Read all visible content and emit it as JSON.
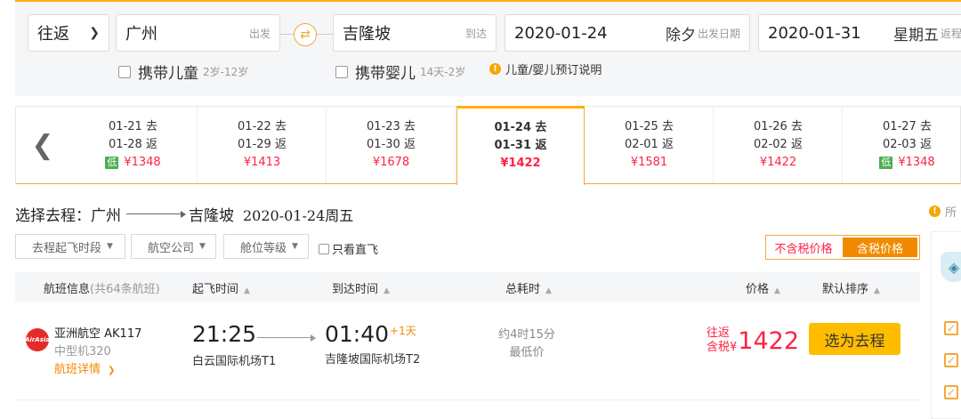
{
  "search": {
    "trip_type": "往返",
    "from_city": "广州",
    "from_hint": "出发",
    "to_city": "吉隆坡",
    "to_hint": "到达",
    "depart_date": "2020-01-24",
    "depart_day": "除夕",
    "depart_hint": "出发日期",
    "return_date": "2020-01-31",
    "return_day": "星期五",
    "return_hint": "返程",
    "child_label": "携带儿童",
    "child_age": "2岁-12岁",
    "infant_label": "携带婴儿",
    "infant_age": "14天-2岁",
    "booking_note": "儿童/婴儿预订说明"
  },
  "date_strip": [
    {
      "go": "01-21 去",
      "back": "01-28 返",
      "price": "¥1348",
      "low": "低",
      "active": false
    },
    {
      "go": "01-22 去",
      "back": "01-29 返",
      "price": "¥1413",
      "low": "",
      "active": false
    },
    {
      "go": "01-23 去",
      "back": "01-30 返",
      "price": "¥1678",
      "low": "",
      "active": false
    },
    {
      "go": "01-24 去",
      "back": "01-31 返",
      "price": "¥1422",
      "low": "",
      "active": true
    },
    {
      "go": "01-25 去",
      "back": "02-01 返",
      "price": "¥1581",
      "low": "",
      "active": false
    },
    {
      "go": "01-26 去",
      "back": "02-02 返",
      "price": "¥1422",
      "low": "",
      "active": false
    },
    {
      "go": "01-27 去",
      "back": "02-03 返",
      "price": "¥1348",
      "low": "低",
      "active": false
    }
  ],
  "outbound": {
    "prefix": "选择去程：",
    "from": "广州",
    "to": "吉隆坡",
    "date": "2020-01-24周五",
    "side_tip": "所"
  },
  "filters": {
    "depart_period": "去程起飞时段",
    "airline": "航空公司",
    "cabin": "舱位等级",
    "direct_only": "只看直飞",
    "price_excl_tax": "不含税价格",
    "price_incl_tax": "含税价格"
  },
  "table_header": {
    "flight_info": "航班信息",
    "flight_count": "(共64条航班)",
    "depart_time": "起飞时间",
    "arrive_time": "到达时间",
    "duration": "总耗时",
    "price": "价格",
    "sort": "默认排序"
  },
  "flight": {
    "logo_text": "AirAsia",
    "airline": "亚洲航空 AK117",
    "aircraft": "中型机320",
    "detail_link": "航班详情",
    "depart_time": "21:25",
    "depart_airport": "白云国际机场T1",
    "arrive_time": "01:40",
    "arrive_plus": "+1天",
    "arrive_airport": "吉隆坡国际机场T2",
    "duration": "约4时15分",
    "duration_tag": "最低价",
    "price_label_1": "往返",
    "price_label_2": "含税",
    "price_currency": "¥",
    "price": "1422",
    "select_label": "选为去程"
  },
  "icons": {
    "info": "info-icon",
    "swap": "swap-icon",
    "prev": "chevron-left-icon",
    "check": "checkbox-checked-icon"
  },
  "colors": {
    "accent": "#ffb000",
    "price": "#ff2244",
    "low_badge": "#4caf50",
    "button": "#ffbd00"
  }
}
